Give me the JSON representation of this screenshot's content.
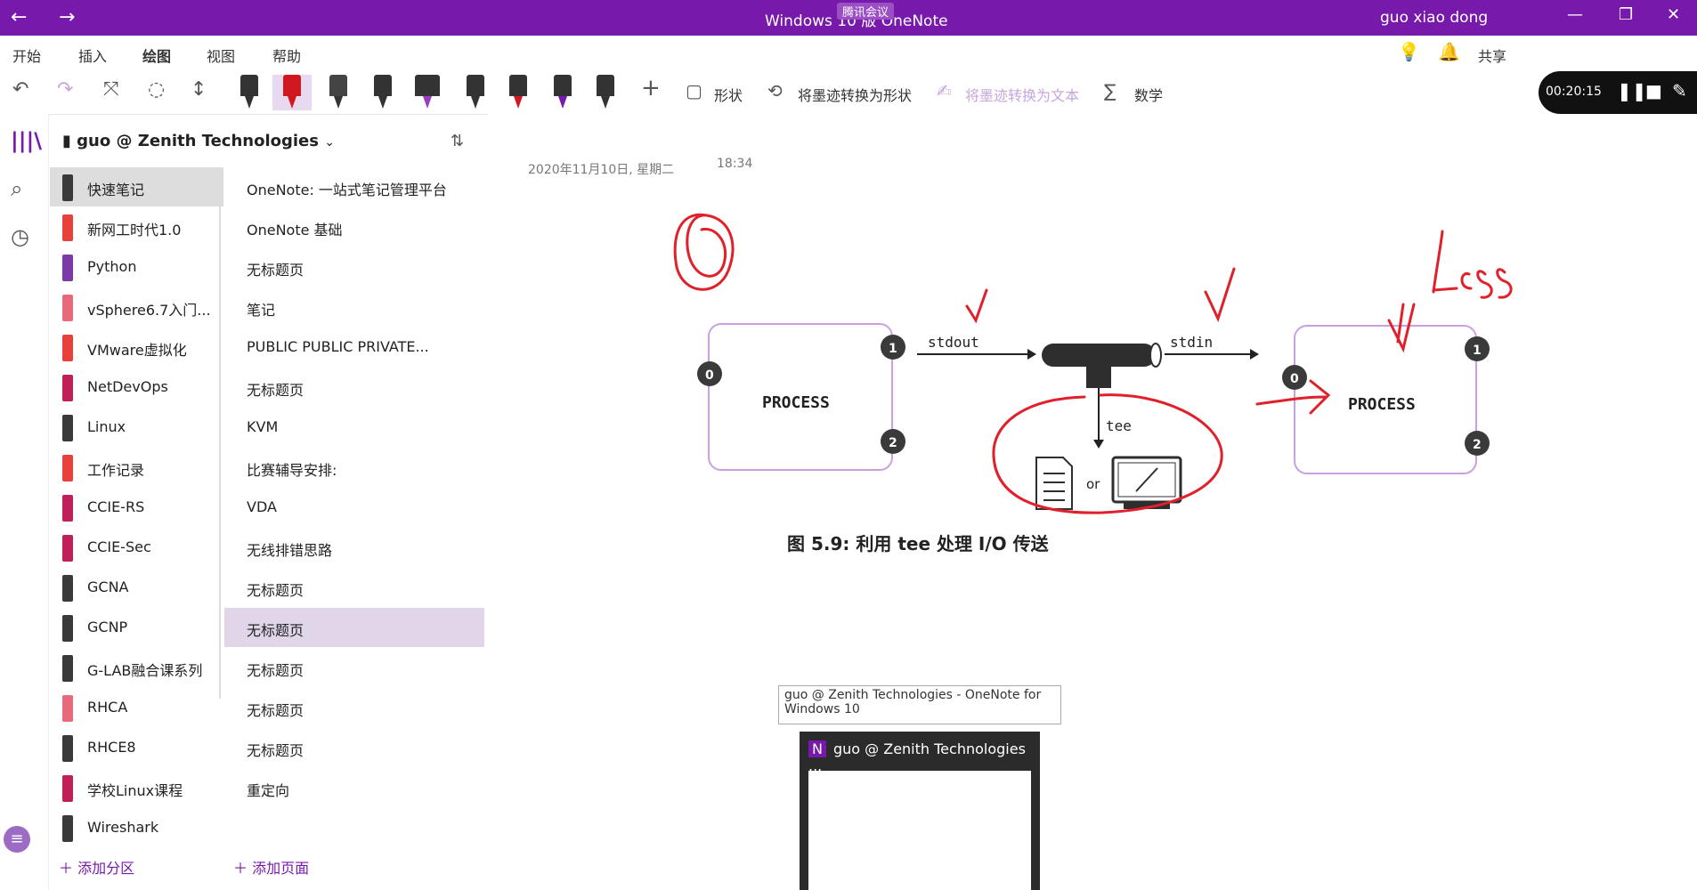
{
  "window": {
    "title": "Windows 10 版 OneNote",
    "meeting_badge": "腾讯会议",
    "user": "guo xiao dong",
    "back": "←",
    "forward": "→",
    "minimize": "—",
    "maximize": "❐",
    "close": "✕"
  },
  "tabs": [
    "开始",
    "插入",
    "绘图",
    "视图",
    "帮助"
  ],
  "ribbon": {
    "shapes_label": "形状",
    "ink_to_shape": "将墨迹转换为形状",
    "ink_to_text": "将墨迹转换为文本",
    "math": "数学",
    "share": "共享"
  },
  "recorder": {
    "time": "00:20:15"
  },
  "notebook": {
    "name": "guo @ Zenith Technologies"
  },
  "sections": [
    {
      "label": "快速笔记",
      "color": "#3a3a3a"
    },
    {
      "label": "新网工时代1.0",
      "color": "#e8403a"
    },
    {
      "label": "Python",
      "color": "#7a3aa8"
    },
    {
      "label": "vSphere6.7入门...",
      "color": "#e86a7a"
    },
    {
      "label": "VMware虚拟化",
      "color": "#e8403a"
    },
    {
      "label": "NetDevOps",
      "color": "#c0205a"
    },
    {
      "label": "Linux",
      "color": "#3a3a3a"
    },
    {
      "label": "工作记录",
      "color": "#e8403a"
    },
    {
      "label": "CCIE-RS",
      "color": "#c0205a"
    },
    {
      "label": "CCIE-Sec",
      "color": "#c0205a"
    },
    {
      "label": "GCNA",
      "color": "#3a3a3a"
    },
    {
      "label": "GCNP",
      "color": "#3a3a3a"
    },
    {
      "label": "G-LAB融合课系列",
      "color": "#3a3a3a"
    },
    {
      "label": "RHCA",
      "color": "#e86a7a"
    },
    {
      "label": "RHCE8",
      "color": "#3a3a3a"
    },
    {
      "label": "学校Linux课程",
      "color": "#c0205a"
    },
    {
      "label": "Wireshark",
      "color": "#3a3a3a"
    }
  ],
  "pages": [
    {
      "label": "OneNote: 一站式笔记管理平台"
    },
    {
      "label": "OneNote 基础"
    },
    {
      "label": "无标题页"
    },
    {
      "label": "笔记"
    },
    {
      "label": "PUBLIC        PUBLIC PRIVATE..."
    },
    {
      "label": "无标题页"
    },
    {
      "label": "KVM"
    },
    {
      "label": "比赛辅导安排:"
    },
    {
      "label": "VDA"
    },
    {
      "label": "无线排错思路"
    },
    {
      "label": "无标题页"
    },
    {
      "label": "无标题页"
    },
    {
      "label": "无标题页"
    },
    {
      "label": "无标题页"
    },
    {
      "label": "无标题页"
    },
    {
      "label": "重定向"
    }
  ],
  "add_section": "添加分区",
  "add_page": "添加页面",
  "note": {
    "date": "2020年11月10日, 星期二",
    "time": "18:34"
  },
  "figure": {
    "process_left": "PROCESS",
    "process_right": "PROCESS",
    "stdout": "stdout",
    "stdin": "stdin",
    "tee": "tee",
    "or": "or",
    "caption": "图 5.9: 利用 tee 处理 I/O 传送",
    "port0": "0",
    "port1": "1",
    "port2": "2",
    "ink_word": "Less"
  },
  "taskbar_preview": {
    "tooltip": "guo @ Zenith Technologies - OneNote for Windows 10",
    "title": "guo @ Zenith Technologies ..."
  },
  "colors": {
    "brand": "#7719aa",
    "ink": "#e0202a"
  }
}
